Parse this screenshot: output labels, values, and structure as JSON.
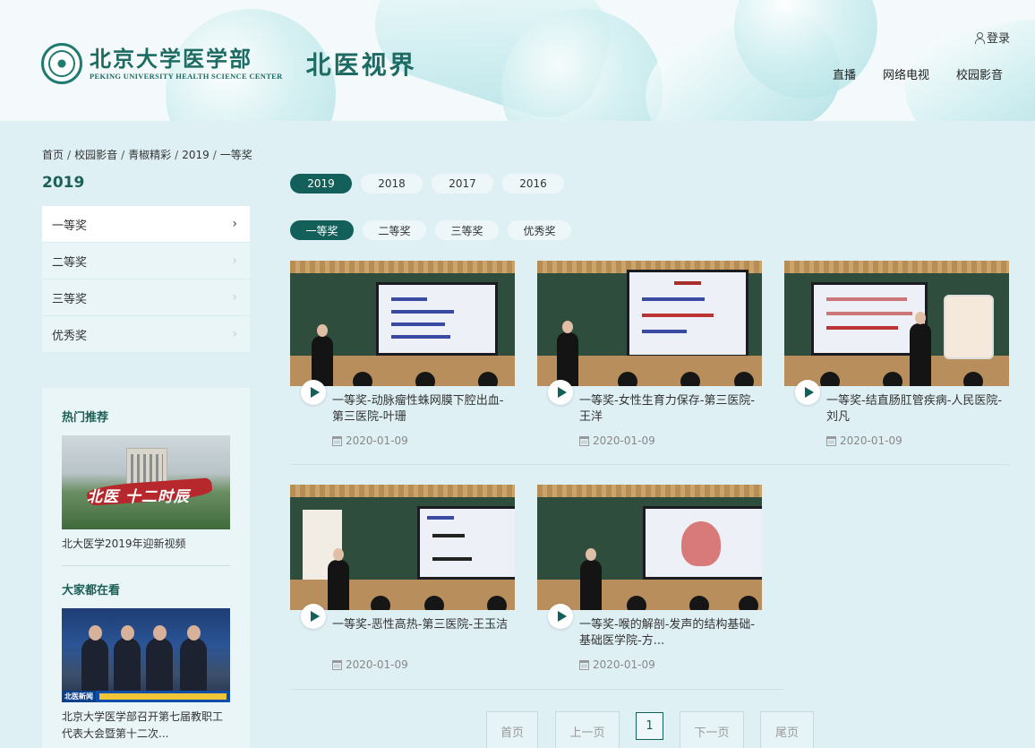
{
  "header": {
    "logo_cn": "北京大学医学部",
    "logo_en": "PEKING UNIVERSITY HEALTH SCIENCE CENTER",
    "site_name": "北医视界",
    "login": "登录",
    "nav": [
      "直播",
      "网络电视",
      "校园影音"
    ]
  },
  "breadcrumb": [
    "首页",
    "校园影音",
    "青椒精彩",
    "2019",
    "一等奖"
  ],
  "sidebar": {
    "title": "2019",
    "items": [
      {
        "label": "一等奖",
        "active": true
      },
      {
        "label": "二等奖",
        "active": false
      },
      {
        "label": "三等奖",
        "active": false
      },
      {
        "label": "优秀奖",
        "active": false
      }
    ],
    "hot": {
      "heading": "热门推荐",
      "thumb_caption": "北医 十二时辰",
      "caption": "北大医学2019年迎新视频"
    },
    "popular": {
      "heading": "大家都在看",
      "ticker": "北医新闻",
      "caption": "北京大学医学部召开第七届教职工代表大会暨第十二次..."
    }
  },
  "filters": {
    "years": [
      {
        "label": "2019",
        "active": true
      },
      {
        "label": "2018",
        "active": false
      },
      {
        "label": "2017",
        "active": false
      },
      {
        "label": "2016",
        "active": false
      }
    ],
    "awards": [
      {
        "label": "一等奖",
        "active": true
      },
      {
        "label": "二等奖",
        "active": false
      },
      {
        "label": "三等奖",
        "active": false
      },
      {
        "label": "优秀奖",
        "active": false
      }
    ]
  },
  "videos": [
    {
      "title": "一等奖-动脉瘤性蛛网膜下腔出血-第三医院-叶珊",
      "date": "2020-01-09"
    },
    {
      "title": "一等奖-女性生育力保存-第三医院-王洋",
      "date": "2020-01-09"
    },
    {
      "title": "一等奖-结直肠肛管疾病-人民医院-刘凡",
      "date": "2020-01-09"
    },
    {
      "title": "一等奖-恶性高热-第三医院-王玉洁",
      "date": "2020-01-09"
    },
    {
      "title": "一等奖-喉的解剖-发声的结构基础-基础医学院-方...",
      "date": "2020-01-09"
    }
  ],
  "pagination": {
    "first": "首页",
    "prev": "上一页",
    "current": "1",
    "next": "下一页",
    "last": "尾页"
  },
  "colors": {
    "accent": "#13605a",
    "background": "#dff0f4"
  }
}
